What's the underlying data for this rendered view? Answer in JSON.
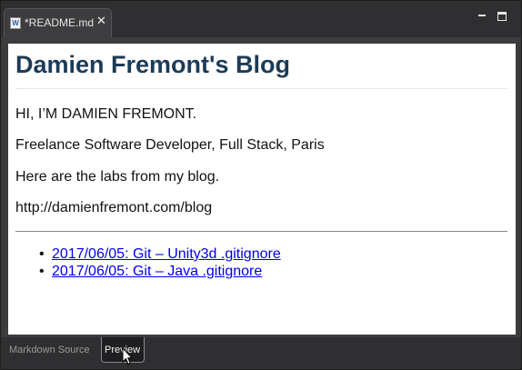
{
  "tab": {
    "icon": "markdown-file-icon",
    "title": "*README.md",
    "close": "✕"
  },
  "window_controls": {
    "minimize": "minimize-icon",
    "maximize": "maximize-icon"
  },
  "preview": {
    "title": "Damien Fremont's Blog",
    "paragraphs": [
      "HI, I’M DAMIEN FREMONT.",
      "Freelance Software Developer, Full Stack, Paris",
      "Here are the labs from my blog.",
      "http://damienfremont.com/blog"
    ],
    "links": [
      "2017/06/05: Git – Unity3d .gitignore",
      "2017/06/05: Git – Java .gitignore"
    ],
    "bullet": "•"
  },
  "bottom_tabs": {
    "source": "Markdown Source",
    "preview": "Preview",
    "active": "Preview"
  },
  "colors": {
    "heading": "#1c3b57",
    "link": "#0000ee",
    "chrome": "#2f2f31"
  }
}
